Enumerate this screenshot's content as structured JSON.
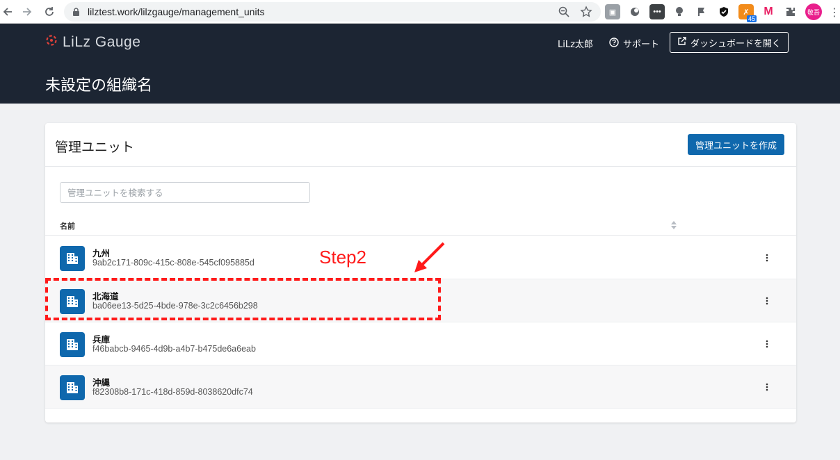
{
  "browser": {
    "url": "lilztest.work/lilzgauge/management_units",
    "extension_badge": "45",
    "avatar_text": "敬吾"
  },
  "header": {
    "logo_text": "LiLz Gauge",
    "user_name": "LiLz太郎",
    "support_label": "サポート",
    "dashboard_button_label": "ダッシュボードを開く",
    "org_title": "未設定の組織名"
  },
  "card": {
    "title": "管理ユニット",
    "create_button_label": "管理ユニットを作成",
    "search_placeholder": "管理ユニットを検索する",
    "column_name_label": "名前",
    "units": [
      {
        "name": "九州",
        "id": "9ab2c171-809c-415c-808e-545cf095885d"
      },
      {
        "name": "北海道",
        "id": "ba06ee13-5d25-4bde-978e-3c2c6456b298"
      },
      {
        "name": "兵庫",
        "id": "f46babcb-9465-4d9b-a4b7-b475de6a6eab"
      },
      {
        "name": "沖縄",
        "id": "f82308b8-171c-418d-859d-8038620dfc74"
      }
    ]
  },
  "annotation": {
    "step_label": "Step2",
    "color": "#ff1a1a"
  },
  "colors": {
    "header_bg": "#1c2533",
    "accent": "#0f68ad",
    "logo_mark": "#e0413a"
  }
}
